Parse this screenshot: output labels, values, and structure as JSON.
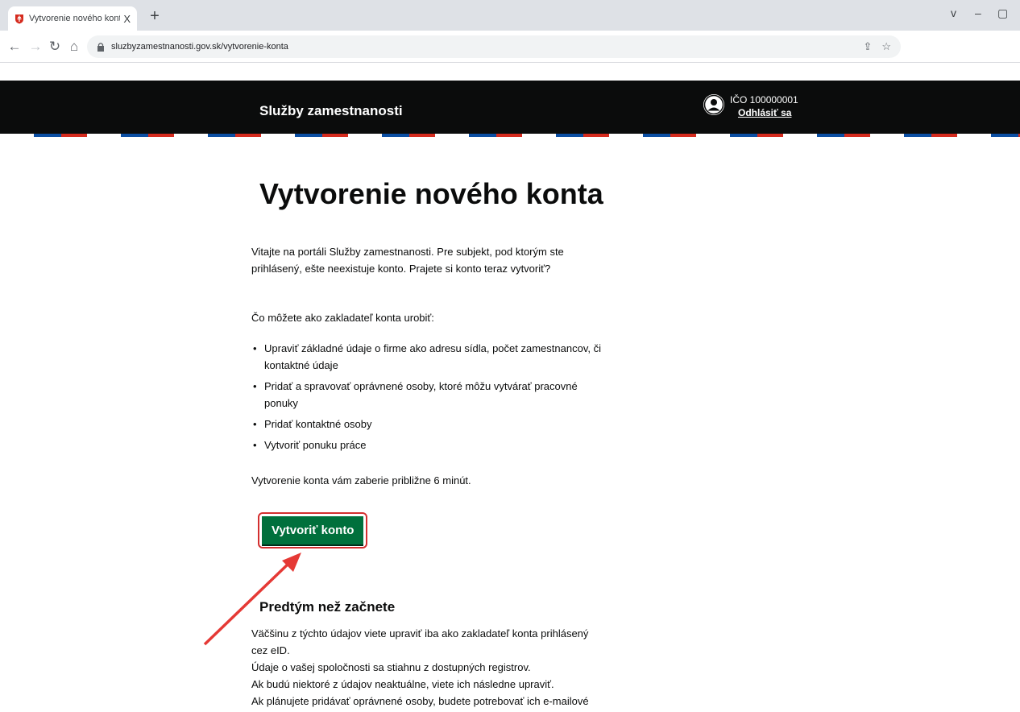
{
  "browser": {
    "tab_title": "Vytvorenie nového konta - Služb",
    "tab_close": "X",
    "new_tab": "+",
    "url": "sluzbyzamestnanosti.gov.sk/vytvorenie-konta",
    "window_controls": [
      "v",
      "–",
      "▢"
    ]
  },
  "header": {
    "site_title": "Služby zamestnanosti",
    "user_id": "IČO 100000001",
    "logout_label": "Odhlásiť sa"
  },
  "main": {
    "title": "Vytvorenie nového konta",
    "intro": "Vitajte na portáli Služby zamestnanosti. Pre subjekt, pod ktorým ste prihlásený, ešte neexistuje konto. Prajete si konto teraz vytvoriť?",
    "list_heading": "Čo môžete ako zakladateľ konta urobiť:",
    "list_items": [
      "Upraviť základné údaje o firme ako adresu sídla, počet zamestnancov, či kontaktné údaje",
      "Pridať a spravovať oprávnené osoby, ktoré môžu vytvárať pracovné ponuky",
      "Pridať kontaktné osoby",
      "Vytvoriť ponuku práce"
    ],
    "duration_note": "Vytvorenie konta vám zaberie približne 6 minút.",
    "cta_label": "Vytvoriť konto",
    "before_heading": "Predtým než začnete",
    "before_lines": [
      "Väčšinu z týchto údajov viete upraviť iba ako zakladateľ konta prihlásený cez eID.",
      "Údaje o vašej spoločnosti sa stiahnu z dostupných registrov.",
      "Ak budú niektoré z údajov neaktuálne, viete ich následne upraviť.",
      "Ak plánujete pridávať oprávnené osoby, budete potrebovať ich e-mailové"
    ]
  },
  "colors": {
    "header_bg": "#0b0c0c",
    "cta_bg": "#00703c",
    "annotation": "#e53935"
  },
  "icons": {
    "favicon": "slovak-coat-of-arms-icon",
    "lock": "lock-icon",
    "share": "share-icon",
    "bookmark": "star-icon",
    "user": "user-avatar-icon",
    "annotation": "red-arrow-icon"
  }
}
